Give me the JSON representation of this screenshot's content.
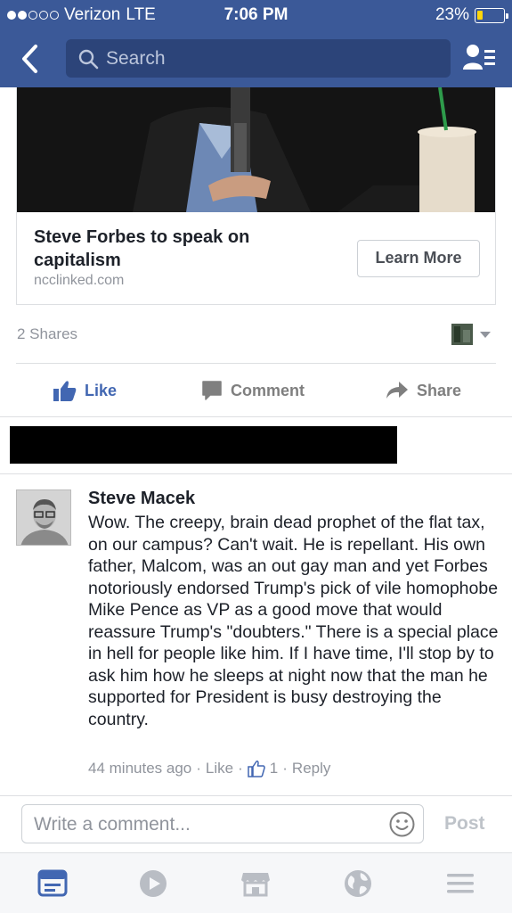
{
  "status_bar": {
    "carrier": "Verizon",
    "network": "LTE",
    "time": "7:06 PM",
    "battery_percent": "23%",
    "battery_level": 0.23,
    "signal_bars_filled": 2,
    "signal_bars_total": 5
  },
  "nav": {
    "search_placeholder": "Search",
    "back_icon": "chevron-left-icon",
    "friends_icon": "friend-list-icon",
    "bar_color": "#3b5998"
  },
  "link_card": {
    "title": "Steve Forbes to speak on capitalism",
    "domain": "ncclinked.com",
    "cta_label": "Learn More"
  },
  "post_stats": {
    "shares": "2 Shares"
  },
  "actions": {
    "like": "Like",
    "comment": "Comment",
    "share": "Share"
  },
  "comment": {
    "author": "Steve Macek",
    "text": "Wow. The creepy, brain dead prophet of the flat tax, on our campus? Can't wait. He is repellant. His own father, Malcom, was an out gay man and yet Forbes notoriously endorsed Trump's pick of vile homophobe Mike Pence as VP as a good move that would reassure Trump's \"doubters.\" There is a special place in hell for people like him. If I have time, I'll stop by to ask him how he sleeps at night now that the man he supported for President is busy destroying the country.",
    "time": "44 minutes ago",
    "separator": "·",
    "like_label": "Like",
    "like_count": "1",
    "reply_label": "Reply"
  },
  "composer": {
    "placeholder": "Write a comment...",
    "post_label": "Post"
  },
  "tab_bar": {
    "icons": [
      "news-feed-icon",
      "video-icon",
      "marketplace-icon",
      "globe-icon",
      "menu-icon"
    ],
    "active": "news-feed-icon",
    "accent_color": "#4267b2"
  }
}
